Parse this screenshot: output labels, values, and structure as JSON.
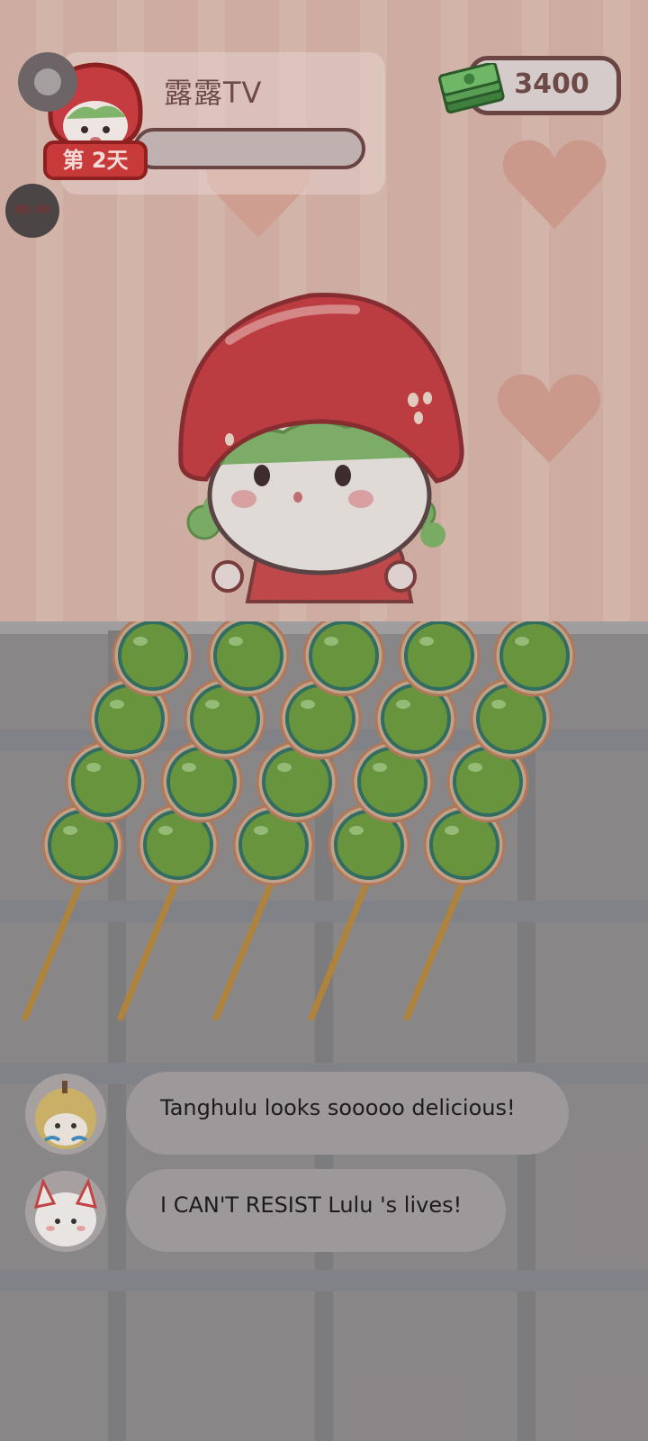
{
  "hud": {
    "streamer_name": "露露TV",
    "day_label": "第 2天",
    "coins": "3400",
    "timer_text": "00:49",
    "progress_fraction": 0.0
  },
  "scene": {
    "skewer_count": 5,
    "balls_per_skewer": 4,
    "colors": {
      "candy_green": "#6a9a3c",
      "strawberry_red": "#c53a3f",
      "stick": "#b8873a"
    }
  },
  "icons": {
    "menu": "menu-icon",
    "timer": "timer-icon",
    "cash": "cash-stack-icon"
  },
  "chat": [
    {
      "user_avatar": "chick-avatar",
      "message": "Tanghulu looks sooooo delicious!"
    },
    {
      "user_avatar": "bunny-avatar",
      "message": "I CAN'T RESIST Lulu 's lives!"
    }
  ]
}
